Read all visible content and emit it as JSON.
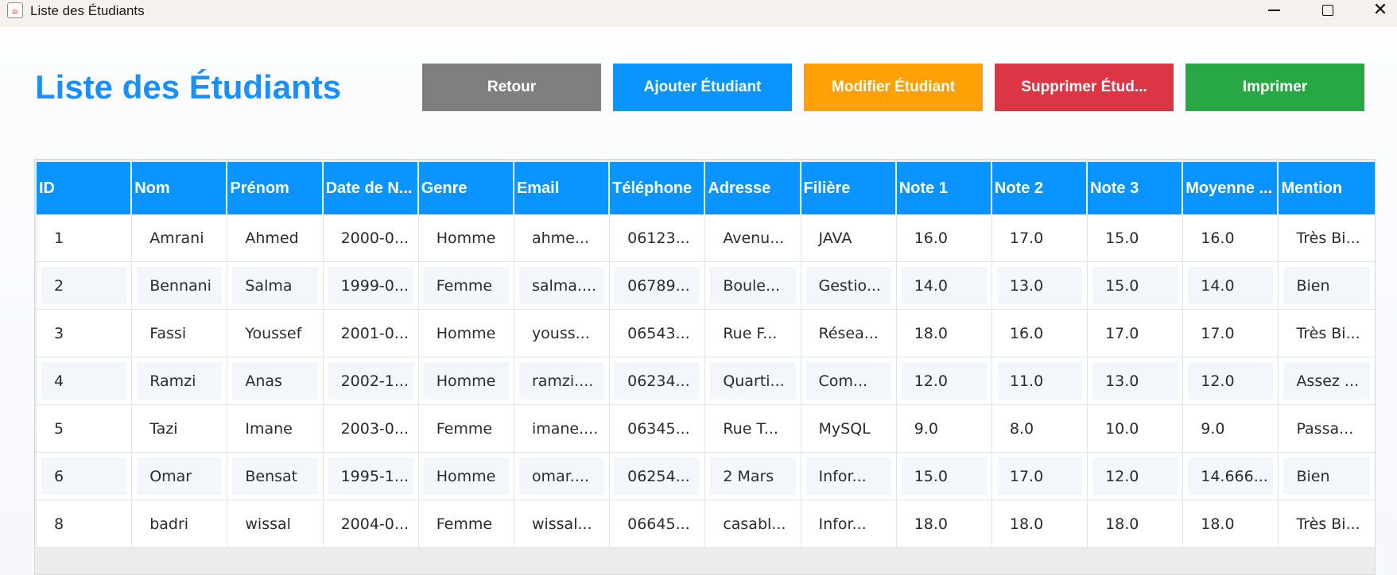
{
  "window": {
    "title": "Liste des Étudiants",
    "icon": "java-cup-icon"
  },
  "page": {
    "title": "Liste des Étudiants"
  },
  "buttons": {
    "retour": "Retour",
    "ajouter": "Ajouter Étudiant",
    "modifier": "Modifier Étudiant",
    "supprimer": "Supprimer Étud...",
    "imprimer": "Imprimer"
  },
  "colors": {
    "accent": "#1890ff",
    "retour": "#7f7f7f",
    "ajouter": "#0994ff",
    "modifier": "#ffa005",
    "supprimer": "#dc3545",
    "imprimer": "#28a745"
  },
  "table": {
    "columns": [
      "ID",
      "Nom",
      "Prénom",
      "Date de N...",
      "Genre",
      "Email",
      "Téléphone",
      "Adresse",
      "Filière",
      "Note 1",
      "Note 2",
      "Note 3",
      "Moyenne ...",
      "Mention"
    ],
    "rows": [
      [
        "1",
        "Amrani",
        "Ahmed",
        "2000-0...",
        "Homme",
        "ahme...",
        "06123...",
        "Avenu...",
        "JAVA",
        "16.0",
        "17.0",
        "15.0",
        "16.0",
        "Très Bi..."
      ],
      [
        "2",
        "Bennani",
        "Salma",
        "1999-0...",
        "Femme",
        "salma....",
        "06789...",
        "Boule...",
        "Gestio...",
        "14.0",
        "13.0",
        "15.0",
        "14.0",
        "Bien"
      ],
      [
        "3",
        "Fassi",
        "Youssef",
        "2001-0...",
        "Homme",
        "youss...",
        "06543...",
        "Rue F...",
        "Résea...",
        "18.0",
        "16.0",
        "17.0",
        "17.0",
        "Très Bi..."
      ],
      [
        "4",
        "Ramzi",
        "Anas",
        "2002-1...",
        "Homme",
        "ramzi....",
        "06234...",
        "Quarti...",
        "Com...",
        "12.0",
        "11.0",
        "13.0",
        "12.0",
        "Assez ..."
      ],
      [
        "5",
        "Tazi",
        "Imane",
        "2003-0...",
        "Femme",
        "imane....",
        "06345...",
        "Rue T...",
        "MySQL",
        "9.0",
        "8.0",
        "10.0",
        "9.0",
        "Passa..."
      ],
      [
        "6",
        "Omar",
        "Bensat",
        "1995-1...",
        "Homme",
        "omar....",
        "06254...",
        "2 Mars",
        "Infor...",
        "15.0",
        "17.0",
        "12.0",
        "14.666...",
        "Bien"
      ],
      [
        "8",
        "badri",
        "wissal",
        "2004-0...",
        "Femme",
        "wissal...",
        "06645...",
        "casabl...",
        "Infor...",
        "18.0",
        "18.0",
        "18.0",
        "18.0",
        "Très Bi..."
      ]
    ]
  }
}
